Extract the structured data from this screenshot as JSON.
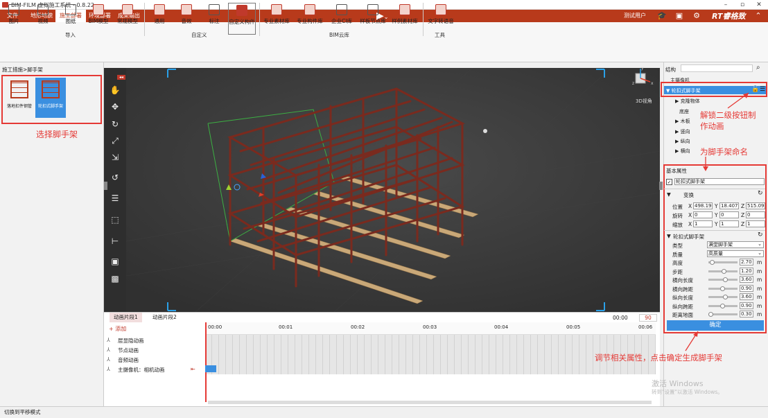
{
  "window": {
    "title": "BIM-FILM 虚拟施工系统 - 0.8.22",
    "minimize": "–",
    "maximize": "▫",
    "close": "✕"
  },
  "menu": {
    "tabs": [
      "文件",
      "地形地貌",
      "施工部署",
      "环境部署",
      "成果输出"
    ],
    "user": "测试用户",
    "brand": "RT睿格致",
    "play_icon": "▶"
  },
  "ribbon": {
    "import": {
      "items": [
        "图片",
        "视频",
        "图纸",
        "BIM模型",
        "常规模型"
      ],
      "group": "导入"
    },
    "custom": {
      "items": [
        "通用",
        "音效",
        "标注",
        "自定义构件"
      ],
      "group": "自定义"
    },
    "cloud": {
      "items": [
        "专业素材库",
        "专业构件库",
        "企业CI库",
        "样板节点库",
        "样例素材库"
      ],
      "group": "BIM云库"
    },
    "tools": {
      "items": [
        "文字转语音"
      ],
      "group": "工具"
    }
  },
  "left": {
    "breadcrumb": "施工措施>脚手架",
    "items": [
      "落地扣件钢管",
      "轮扣式脚手架"
    ],
    "annotation": "选择脚手架"
  },
  "viewport": {
    "view_label": "3D视角",
    "axes": {
      "x": "x",
      "y": "y",
      "z": "z"
    }
  },
  "timeline": {
    "tabs": [
      "动画片段1",
      "动画片段2"
    ],
    "time": "00:00",
    "end": "90",
    "add": "+ 添加",
    "ticks": [
      "00:00",
      "00:01",
      "00:02",
      "00:03",
      "00:04",
      "00:05",
      "00:06"
    ],
    "rows": [
      "层显隐动画",
      "节点动画",
      "音频动画",
      "主摄像机：相机动画"
    ]
  },
  "right": {
    "structure_title": "结构",
    "tree": [
      "主摄像机",
      "轮扣式脚手架",
      "▶ 克隆物体",
      "底座",
      "▶ 木板",
      "▶ 竖向",
      "▶ 纵向",
      "▶ 横向"
    ],
    "basic_title": "基本属性",
    "name_value": "轮扣式脚手架",
    "transform_title": "变换",
    "transform": {
      "rows": [
        "位置",
        "旋转",
        "缩放"
      ],
      "pos": [
        "498.19",
        "18.407",
        "515.09"
      ],
      "rot": [
        "0",
        "0",
        "0"
      ],
      "scale": [
        "1",
        "1",
        "1"
      ],
      "axes": [
        "X",
        "Y",
        "Z"
      ]
    },
    "scaffold_title": "轮扣式脚手架",
    "props": [
      {
        "label": "类型",
        "value": "满堂脚手架",
        "level": null
      },
      {
        "label": "质量",
        "value": "高质量",
        "level": null
      },
      {
        "label": "高度",
        "value": "2.70",
        "unit": "m",
        "level": 0.1
      },
      {
        "label": "步距",
        "value": "1.20",
        "unit": "m",
        "level": 0.55
      },
      {
        "label": "横向长度",
        "value": "3.60",
        "unit": "m",
        "level": 0.6
      },
      {
        "label": "横向跨距",
        "value": "0.90",
        "unit": "m",
        "level": 0.5
      },
      {
        "label": "纵向长度",
        "value": "3.60",
        "unit": "m",
        "level": 0.6
      },
      {
        "label": "纵向跨距",
        "value": "0.90",
        "unit": "m",
        "level": 0.5
      },
      {
        "label": "距离地面",
        "value": "0.30",
        "unit": "m",
        "level": 0.05
      }
    ],
    "confirm": "确定"
  },
  "annotations": {
    "unlock": "解锁二级按钮制\n作动画",
    "name": "为脚手架命名",
    "adjust": "调节相关属性，点击确定生成脚手架"
  },
  "watermark": {
    "line1": "激活 Windows",
    "line2": "转到\"设置\"以激活 Windows。"
  },
  "status": "切换到平移模式",
  "colors": {
    "accent": "#b83a1b",
    "confirm": "#3a8fe0",
    "annotation": "#e53935"
  }
}
